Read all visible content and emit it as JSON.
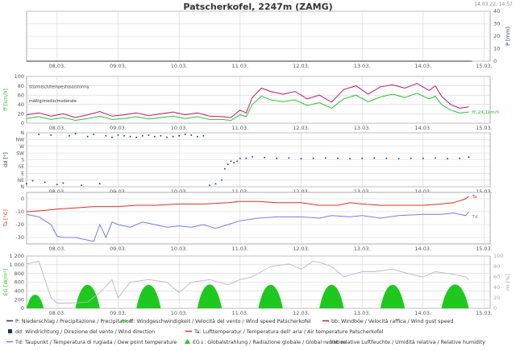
{
  "title": "Patscherkofel, 2247m (ZAMG)",
  "timestamp": "14.03.22, 14:57",
  "date_ticks": [
    "08.03.",
    "09.03.",
    "10.03.",
    "11.03.",
    "12.03.",
    "13.03.",
    "14.03.",
    "15.03."
  ],
  "colors": {
    "precip": "#2a2a9a",
    "wind": "#2ec02e",
    "gust": "#c0186a",
    "direction": "#103a5a",
    "temp": "#e03020",
    "dew": "#7a7ae8",
    "radiation": "#1ec81e",
    "humidity": "#b8b8c8",
    "grid": "#d2d2d2",
    "frame": "#999999",
    "text": "#555555"
  },
  "chart_data": [
    {
      "type": "line",
      "name": "precipitation",
      "ylabel": "P [mm]",
      "ylim": [
        0,
        40
      ],
      "yticks": [
        0,
        10,
        20,
        30,
        40
      ],
      "axis_side": "right",
      "x_range": [
        7.5,
        15.1
      ],
      "series": [
        {
          "key": "p",
          "x": [
            7.5,
            14.8
          ],
          "values": [
            0,
            0
          ]
        }
      ]
    },
    {
      "type": "line",
      "name": "wind",
      "ylabel": "ff [km/h]",
      "ylim": [
        0,
        100
      ],
      "yticks": [
        0,
        20,
        40,
        60,
        80,
        100
      ],
      "axis_side": "left",
      "x_range": [
        7.5,
        15.1
      ],
      "annotations": [
        "stürmisch/tempestoso/stormy",
        "mäßig/medio/moderate"
      ],
      "annotation_levels": [
        75,
        45
      ],
      "end_label": "ff: 24.1km/h",
      "series": [
        {
          "key": "gust",
          "x": [
            7.5,
            7.7,
            7.9,
            8.1,
            8.3,
            8.5,
            8.7,
            8.9,
            9.1,
            9.3,
            9.5,
            9.7,
            9.9,
            10.1,
            10.3,
            10.5,
            10.7,
            10.85,
            11.0,
            11.1,
            11.2,
            11.35,
            11.5,
            11.7,
            11.9,
            12.1,
            12.3,
            12.5,
            12.7,
            12.9,
            13.1,
            13.3,
            13.5,
            13.7,
            13.9,
            14.1,
            14.2,
            14.3,
            14.45,
            14.6,
            14.75
          ],
          "values": [
            18,
            22,
            15,
            20,
            12,
            18,
            25,
            15,
            18,
            22,
            16,
            20,
            24,
            18,
            22,
            15,
            14,
            12,
            28,
            22,
            55,
            75,
            68,
            62,
            68,
            52,
            60,
            45,
            72,
            80,
            62,
            78,
            82,
            75,
            85,
            70,
            80,
            58,
            40,
            32,
            35
          ]
        },
        {
          "key": "wind",
          "x": [
            7.5,
            7.7,
            7.9,
            8.1,
            8.3,
            8.5,
            8.7,
            8.9,
            9.1,
            9.3,
            9.5,
            9.7,
            9.9,
            10.1,
            10.3,
            10.5,
            10.7,
            10.85,
            11.0,
            11.1,
            11.2,
            11.35,
            11.5,
            11.7,
            11.9,
            12.1,
            12.3,
            12.5,
            12.7,
            12.9,
            13.1,
            13.3,
            13.5,
            13.7,
            13.9,
            14.1,
            14.2,
            14.3,
            14.45,
            14.6,
            14.75
          ],
          "values": [
            10,
            14,
            8,
            12,
            6,
            10,
            15,
            8,
            10,
            14,
            9,
            12,
            15,
            10,
            14,
            8,
            8,
            6,
            18,
            14,
            40,
            58,
            50,
            46,
            50,
            38,
            44,
            32,
            52,
            60,
            46,
            56,
            62,
            55,
            64,
            52,
            58,
            40,
            28,
            22,
            24
          ]
        }
      ]
    },
    {
      "type": "scatter",
      "name": "wind-direction",
      "ylabel": "dd [°]",
      "ylim": [
        0,
        360
      ],
      "ytick_labels": [
        "N",
        "NW",
        "W",
        "SW",
        "S",
        "SE",
        "E",
        "NE",
        "N"
      ],
      "ytick_values": [
        360,
        315,
        270,
        225,
        180,
        135,
        90,
        45,
        0
      ],
      "x_range": [
        7.5,
        15.1
      ],
      "series": [
        {
          "key": "direction",
          "x": [
            7.5,
            7.6,
            7.7,
            7.8,
            7.9,
            8.0,
            8.1,
            8.2,
            8.3,
            8.4,
            8.5,
            8.6,
            8.7,
            8.8,
            8.9,
            9.0,
            9.1,
            9.2,
            9.3,
            9.4,
            9.5,
            9.6,
            9.7,
            9.8,
            9.9,
            10.0,
            10.1,
            10.2,
            10.3,
            10.4,
            10.5,
            10.6,
            10.7,
            10.75,
            10.8,
            10.85,
            10.9,
            10.95,
            11.0,
            11.1,
            11.2,
            11.4,
            11.6,
            11.8,
            12.0,
            12.2,
            12.4,
            12.6,
            12.8,
            13.0,
            13.2,
            13.4,
            13.6,
            13.8,
            14.0,
            14.2,
            14.4,
            14.6,
            14.75
          ],
          "values": [
            20,
            40,
            350,
            30,
            345,
            15,
            25,
            340,
            355,
            10,
            335,
            350,
            20,
            340,
            330,
            345,
            340,
            335,
            330,
            340,
            345,
            335,
            340,
            330,
            335,
            340,
            350,
            345,
            335,
            340,
            10,
            20,
            45,
            120,
            150,
            170,
            160,
            170,
            190,
            190,
            200,
            195,
            190,
            192,
            188,
            190,
            192,
            190,
            188,
            190,
            192,
            190,
            188,
            190,
            190,
            192,
            188,
            190,
            198
          ]
        }
      ]
    },
    {
      "type": "line",
      "name": "temperature",
      "ylabel": "Ta [°C]",
      "ylim": [
        -35,
        5
      ],
      "yticks": [
        -30,
        -20,
        -10,
        0
      ],
      "axis_side": "left",
      "x_range": [
        7.5,
        15.1
      ],
      "end_labels": [
        "Ta",
        "Td"
      ],
      "series": [
        {
          "key": "temp",
          "x": [
            7.5,
            7.8,
            8.0,
            8.3,
            8.6,
            9.0,
            9.3,
            9.6,
            10.0,
            10.4,
            10.8,
            11.0,
            11.3,
            11.6,
            12.0,
            12.3,
            12.6,
            12.8,
            13.0,
            13.3,
            13.6,
            14.0,
            14.3,
            14.5,
            14.7,
            14.75
          ],
          "values": [
            -10,
            -9,
            -8,
            -7,
            -6,
            -6,
            -5,
            -5,
            -4,
            -4,
            -3,
            -2,
            -2,
            -3,
            -3,
            -5,
            -5,
            -3,
            -4,
            -5,
            -5,
            -5,
            -4,
            -3,
            0,
            2
          ]
        },
        {
          "key": "dew",
          "x": [
            7.5,
            7.7,
            7.9,
            8.0,
            8.1,
            8.3,
            8.5,
            8.6,
            8.7,
            8.8,
            8.9,
            9.0,
            9.2,
            9.4,
            9.6,
            9.8,
            10.0,
            10.2,
            10.4,
            10.6,
            10.8,
            11.0,
            11.3,
            11.6,
            12.0,
            12.3,
            12.5,
            12.8,
            13.0,
            13.3,
            13.6,
            14.0,
            14.3,
            14.5,
            14.7,
            14.75
          ],
          "values": [
            -12,
            -14,
            -20,
            -29,
            -30,
            -30,
            -32,
            -33,
            -20,
            -30,
            -18,
            -20,
            -22,
            -18,
            -20,
            -22,
            -21,
            -22,
            -20,
            -23,
            -20,
            -17,
            -15,
            -14,
            -14,
            -15,
            -13,
            -14,
            -13,
            -15,
            -13,
            -12,
            -12,
            -11,
            -13,
            -10
          ]
        }
      ]
    },
    {
      "type": "area",
      "name": "radiation",
      "ylabel": "EG [W/m²]",
      "ylim": [
        0,
        1200
      ],
      "yticks": [
        0,
        200,
        400,
        600,
        800,
        1000,
        1200
      ],
      "ytick_labels": [
        "0",
        "200",
        "400",
        "600",
        "800",
        "1 000",
        "1 200"
      ],
      "y2label": "rH [%]",
      "y2lim": [
        0,
        100
      ],
      "y2ticks": [
        0,
        20,
        40,
        60,
        80,
        100
      ],
      "x_range": [
        7.5,
        15.1
      ],
      "series": [
        {
          "key": "radiation",
          "name": "EG",
          "day_peaks": [
            {
              "day": 7.5,
              "start": 7.5,
              "end": 7.78,
              "peak": 420
            },
            {
              "day": 8.5,
              "start": 8.3,
              "end": 8.7,
              "peak": 720
            },
            {
              "day": 9.5,
              "start": 9.3,
              "end": 9.7,
              "peak": 720
            },
            {
              "day": 10.5,
              "start": 10.3,
              "end": 10.7,
              "peak": 730
            },
            {
              "day": 11.5,
              "start": 11.3,
              "end": 11.7,
              "peak": 720
            },
            {
              "day": 12.5,
              "start": 12.3,
              "end": 12.7,
              "peak": 720
            },
            {
              "day": 13.5,
              "start": 13.3,
              "end": 13.7,
              "peak": 720
            },
            {
              "day": 14.5,
              "start": 14.3,
              "end": 14.75,
              "peak": 730
            }
          ]
        },
        {
          "key": "humidity",
          "name": "rH",
          "x": [
            7.5,
            7.7,
            7.9,
            8.0,
            8.2,
            8.5,
            8.7,
            8.9,
            9.0,
            9.2,
            9.5,
            9.8,
            10.0,
            10.2,
            10.5,
            10.8,
            11.0,
            11.2,
            11.5,
            11.8,
            12.0,
            12.2,
            12.3,
            12.5,
            12.7,
            13.0,
            13.2,
            13.5,
            13.8,
            14.0,
            14.2,
            14.5,
            14.7,
            14.75
          ],
          "values": [
            85,
            90,
            20,
            10,
            10,
            12,
            30,
            55,
            20,
            50,
            55,
            50,
            30,
            50,
            55,
            45,
            55,
            60,
            80,
            85,
            75,
            90,
            88,
            80,
            60,
            70,
            70,
            75,
            65,
            60,
            70,
            65,
            60,
            55
          ]
        }
      ]
    }
  ],
  "legend": [
    {
      "key": "p",
      "marker": "line",
      "label": "P: Niederschlag / Precipitazione / Precipitation"
    },
    {
      "key": "wind",
      "marker": "line",
      "label": "ff: Windgeschwindigkeit / Velocità del vento / Wind speed  Patscherkofel"
    },
    {
      "key": "gust",
      "marker": "line",
      "label": "bb: Windböe / Velocità raffica / Wind gust speed"
    },
    {
      "key": "direction",
      "marker": "square",
      "label": "dd: Windrichtung / Direzione del vento / Wind direction"
    },
    {
      "key": "temp",
      "marker": "line",
      "label": "Ta: Lufttemperatur / Temperatura dell' aria / Air temperature  Patscherkofel"
    },
    {
      "key": "dew",
      "marker": "line",
      "label": "Td: Taupunkt / Temperatura di rugiada / Dew point temperature"
    },
    {
      "key": "radiation",
      "marker": "triangle",
      "label": "EG↓: Globalstrahlung / Radiazione globale / Global radiation"
    },
    {
      "key": "humidity",
      "marker": "line",
      "label": "rH: relative Luftfeuchte / Umidità relativa / Relative humidity"
    }
  ]
}
